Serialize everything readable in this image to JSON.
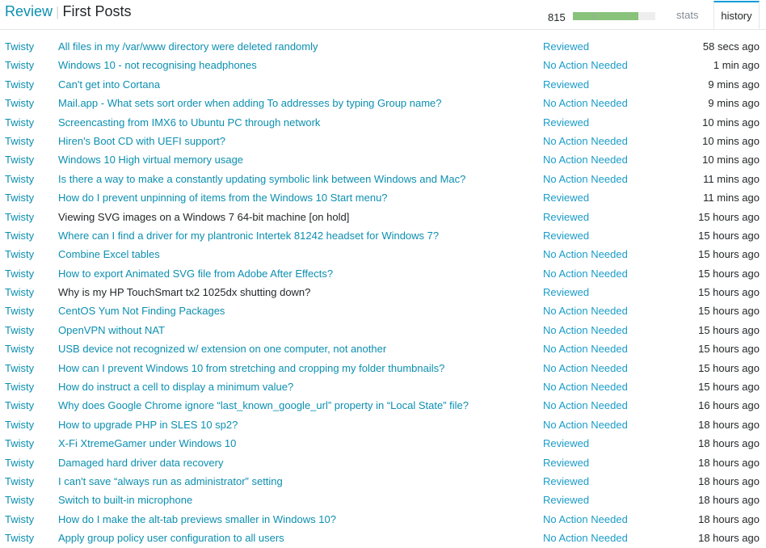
{
  "header": {
    "title_link": "Review",
    "title_separator": "|",
    "queue_name": "First Posts"
  },
  "progress": {
    "count": "815",
    "fill_fraction": 0.79,
    "tick_fraction": 0.25,
    "colors": {
      "fill": "#88c27b",
      "track": "#eeeeee"
    }
  },
  "tabs": [
    {
      "label": "stats",
      "active": false
    },
    {
      "label": "history",
      "active": true
    }
  ],
  "colors": {
    "link": "#0c8fb0",
    "accent": "#0c9cd8",
    "text": "#242729"
  },
  "rows": [
    {
      "user": "Twisty",
      "question": "All files in my /var/www directory were deleted randomly",
      "closed": false,
      "result": "Reviewed",
      "time": "58 secs ago"
    },
    {
      "user": "Twisty",
      "question": "Windows 10 - not recognising headphones",
      "closed": false,
      "result": "No Action Needed",
      "time": "1 min ago"
    },
    {
      "user": "Twisty",
      "question": "Can't get into Cortana",
      "closed": false,
      "result": "Reviewed",
      "time": "9 mins ago"
    },
    {
      "user": "Twisty",
      "question": "Mail.app - What sets sort order when adding To addresses by typing Group name?",
      "closed": false,
      "result": "No Action Needed",
      "time": "9 mins ago"
    },
    {
      "user": "Twisty",
      "question": "Screencasting from IMX6 to Ubuntu PC through network",
      "closed": false,
      "result": "Reviewed",
      "time": "10 mins ago"
    },
    {
      "user": "Twisty",
      "question": "Hiren's Boot CD with UEFI support?",
      "closed": false,
      "result": "No Action Needed",
      "time": "10 mins ago"
    },
    {
      "user": "Twisty",
      "question": "Windows 10 High virtual memory usage",
      "closed": false,
      "result": "No Action Needed",
      "time": "10 mins ago"
    },
    {
      "user": "Twisty",
      "question": "Is there a way to make a constantly updating symbolic link between Windows and Mac?",
      "closed": false,
      "result": "No Action Needed",
      "time": "11 mins ago"
    },
    {
      "user": "Twisty",
      "question": "How do I prevent unpinning of items from the Windows 10 Start menu?",
      "closed": false,
      "result": "Reviewed",
      "time": "11 mins ago"
    },
    {
      "user": "Twisty",
      "question": "Viewing SVG images on a Windows 7 64-bit machine [on hold]",
      "closed": true,
      "result": "Reviewed",
      "time": "15 hours ago"
    },
    {
      "user": "Twisty",
      "question": "Where can I find a driver for my plantronic Intertek 81242 headset for Windows 7?",
      "closed": false,
      "result": "Reviewed",
      "time": "15 hours ago"
    },
    {
      "user": "Twisty",
      "question": "Combine Excel tables",
      "closed": false,
      "result": "No Action Needed",
      "time": "15 hours ago"
    },
    {
      "user": "Twisty",
      "question": "How to export Animated SVG file from Adobe After Effects?",
      "closed": false,
      "result": "No Action Needed",
      "time": "15 hours ago"
    },
    {
      "user": "Twisty",
      "question": "Why is my HP TouchSmart tx2 1025dx shutting down?",
      "closed": true,
      "result": "Reviewed",
      "time": "15 hours ago"
    },
    {
      "user": "Twisty",
      "question": "CentOS Yum Not Finding Packages",
      "closed": false,
      "result": "No Action Needed",
      "time": "15 hours ago"
    },
    {
      "user": "Twisty",
      "question": "OpenVPN without NAT",
      "closed": false,
      "result": "No Action Needed",
      "time": "15 hours ago"
    },
    {
      "user": "Twisty",
      "question": "USB device not recognized w/ extension on one computer, not another",
      "closed": false,
      "result": "No Action Needed",
      "time": "15 hours ago"
    },
    {
      "user": "Twisty",
      "question": "How can I prevent Windows 10 from stretching and cropping my folder thumbnails?",
      "closed": false,
      "result": "No Action Needed",
      "time": "15 hours ago"
    },
    {
      "user": "Twisty",
      "question": "How do instruct a cell to display a minimum value?",
      "closed": false,
      "result": "No Action Needed",
      "time": "15 hours ago"
    },
    {
      "user": "Twisty",
      "question": "Why does Google Chrome ignore “last_known_google_url” property in “Local State” file?",
      "closed": false,
      "result": "No Action Needed",
      "time": "16 hours ago"
    },
    {
      "user": "Twisty",
      "question": "How to upgrade PHP in SLES 10 sp2?",
      "closed": false,
      "result": "No Action Needed",
      "time": "18 hours ago"
    },
    {
      "user": "Twisty",
      "question": "X-Fi XtremeGamer under Windows 10",
      "closed": false,
      "result": "Reviewed",
      "time": "18 hours ago"
    },
    {
      "user": "Twisty",
      "question": "Damaged hard driver data recovery",
      "closed": false,
      "result": "Reviewed",
      "time": "18 hours ago"
    },
    {
      "user": "Twisty",
      "question": "I can't save “always run as administrator” setting",
      "closed": false,
      "result": "Reviewed",
      "time": "18 hours ago"
    },
    {
      "user": "Twisty",
      "question": "Switch to built-in microphone",
      "closed": false,
      "result": "Reviewed",
      "time": "18 hours ago"
    },
    {
      "user": "Twisty",
      "question": "How do I make the alt-tab previews smaller in Windows 10?",
      "closed": false,
      "result": "No Action Needed",
      "time": "18 hours ago"
    },
    {
      "user": "Twisty",
      "question": "Apply group policy user configuration to all users",
      "closed": false,
      "result": "No Action Needed",
      "time": "18 hours ago"
    }
  ]
}
